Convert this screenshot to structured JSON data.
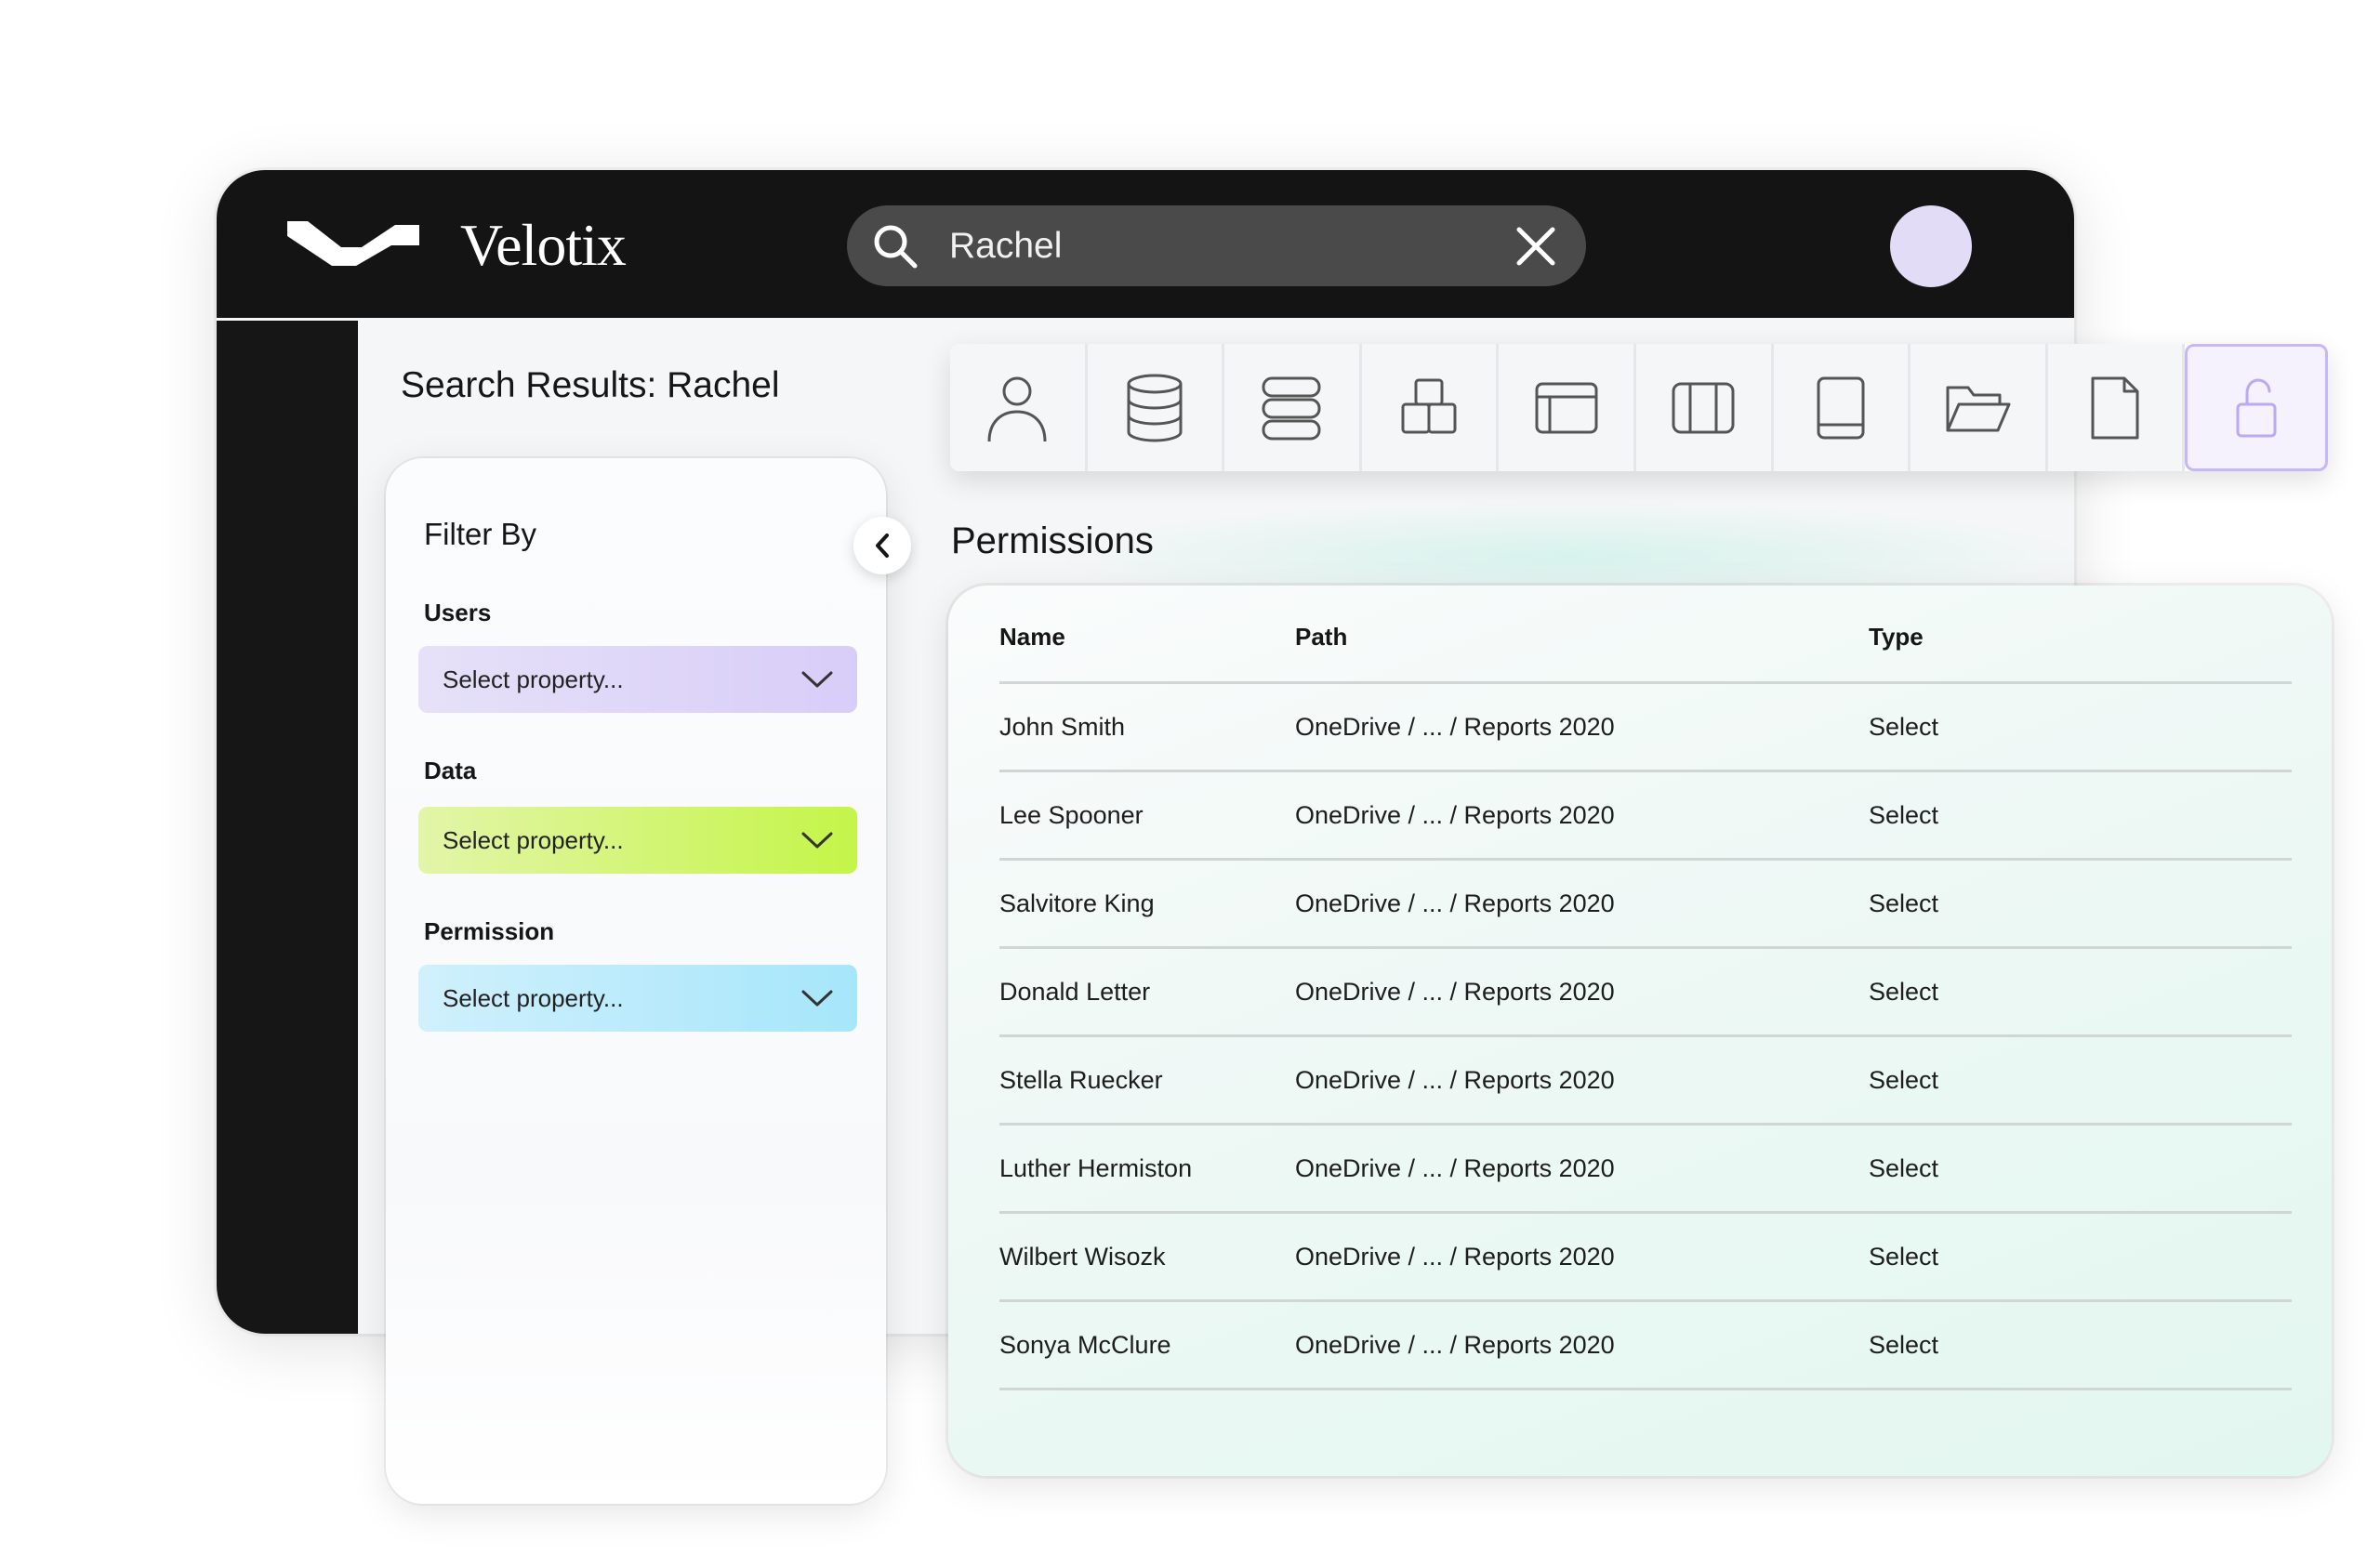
{
  "app": {
    "name": "Velotix",
    "avatar_color": "#e3dcf7"
  },
  "search": {
    "value": "Rachel",
    "icon": "search-icon",
    "clear_icon": "close-icon"
  },
  "page": {
    "title": "Search Results: Rachel"
  },
  "filters": {
    "title": "Filter By",
    "collapse_icon": "chevron-left-icon",
    "groups": [
      {
        "label": "Users",
        "placeholder": "Select property...",
        "color": "#d8cdf8"
      },
      {
        "label": "Data",
        "placeholder": "Select property...",
        "color": "#c4f548"
      },
      {
        "label": "Permission",
        "placeholder": "Select property...",
        "color": "#a6e6fb"
      }
    ]
  },
  "toolbar": {
    "icons": [
      "user-icon",
      "database-icon",
      "server-icon",
      "blocks-icon",
      "window-icon",
      "columns-icon",
      "tablet-icon",
      "folder-open-icon",
      "file-icon",
      "unlock-icon"
    ],
    "active": "unlock-icon",
    "active_color": "#c6b8f5"
  },
  "permissions": {
    "title": "Permissions",
    "columns": [
      "Name",
      "Path",
      "Type"
    ],
    "rows": [
      {
        "name": "John Smith",
        "path": "OneDrive / ... / Reports 2020",
        "type": "Select"
      },
      {
        "name": "Lee Spooner",
        "path": "OneDrive / ... / Reports 2020",
        "type": "Select"
      },
      {
        "name": "Salvitore King",
        "path": "OneDrive / ... / Reports 2020",
        "type": "Select"
      },
      {
        "name": "Donald Letter",
        "path": "OneDrive / ... / Reports 2020",
        "type": "Select"
      },
      {
        "name": "Stella Ruecker",
        "path": "OneDrive / ... / Reports 2020",
        "type": "Select"
      },
      {
        "name": "Luther Hermiston",
        "path": "OneDrive / ... / Reports 2020",
        "type": "Select"
      },
      {
        "name": "Wilbert Wisozk",
        "path": "OneDrive / ... / Reports 2020",
        "type": "Select"
      },
      {
        "name": "Sonya McClure",
        "path": "OneDrive / ... / Reports 2020",
        "type": "Select"
      }
    ]
  }
}
